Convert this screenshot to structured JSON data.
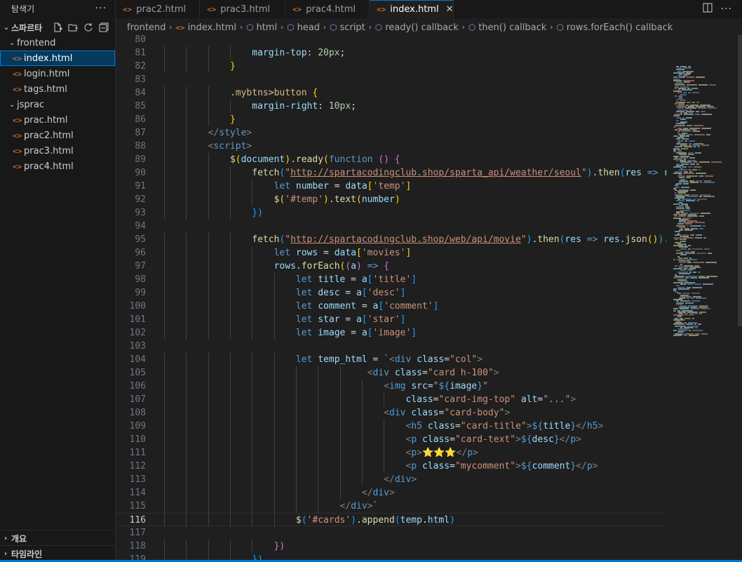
{
  "explorer": {
    "title": "탐색기",
    "more": "···",
    "workspace": "스파르타",
    "items": [
      {
        "label": "frontend",
        "kind": "folder",
        "indent": 1
      },
      {
        "label": "index.html",
        "kind": "file",
        "indent": 2,
        "active": true
      },
      {
        "label": "login.html",
        "kind": "file",
        "indent": 2
      },
      {
        "label": "tags.html",
        "kind": "file",
        "indent": 2
      },
      {
        "label": "jsprac",
        "kind": "folder",
        "indent": 1
      },
      {
        "label": "prac.html",
        "kind": "file",
        "indent": 2
      },
      {
        "label": "prac2.html",
        "kind": "file",
        "indent": 2
      },
      {
        "label": "prac3.html",
        "kind": "file",
        "indent": 2
      },
      {
        "label": "prac4.html",
        "kind": "file",
        "indent": 2
      }
    ],
    "outline_label": "개요",
    "timeline_label": "타임라인"
  },
  "tabs": [
    {
      "label": "prac2.html"
    },
    {
      "label": "prac3.html"
    },
    {
      "label": "prac4.html"
    },
    {
      "label": "index.html",
      "active": true
    }
  ],
  "breadcrumb": [
    "frontend",
    "index.html",
    "html",
    "head",
    "script",
    "ready() callback",
    "then() callback",
    "rows.forEach() callback"
  ],
  "editor": {
    "current_line": 116,
    "lines": [
      {
        "n": "80",
        "ind": 0,
        "html": ""
      },
      {
        "n": "81",
        "ind": 4,
        "html": "<span class='prop'>margin-top</span><span class='plain'>: </span><span class='num'>20px</span><span class='plain'>;</span>"
      },
      {
        "n": "82",
        "ind": 3,
        "html": "<span class='br1'>}</span>"
      },
      {
        "n": "83",
        "ind": 0,
        "html": ""
      },
      {
        "n": "84",
        "ind": 3,
        "html": "<span class='sel'>.mybtns</span><span class='plain'>&gt;</span><span class='sel'>button</span><span class='plain'> </span><span class='br1'>{</span>"
      },
      {
        "n": "85",
        "ind": 4,
        "html": "<span class='prop'>margin-right</span><span class='plain'>: </span><span class='num'>10px</span><span class='plain'>;</span>"
      },
      {
        "n": "86",
        "ind": 3,
        "html": "<span class='br1'>}</span>"
      },
      {
        "n": "87",
        "ind": 2,
        "html": "<span class='tag'>&lt;/</span><span class='tg'>style</span><span class='tag'>&gt;</span>"
      },
      {
        "n": "88",
        "ind": 2,
        "html": "<span class='tag'>&lt;</span><span class='tg'>script</span><span class='tag'>&gt;</span>"
      },
      {
        "n": "89",
        "ind": 3,
        "html": "<span class='fn'>$</span><span class='br1'>(</span><span class='var'>document</span><span class='br1'>)</span><span class='plain'>.</span><span class='fn'>ready</span><span class='br1'>(</span><span class='kw'>function</span><span class='plain'> </span><span class='br2'>()</span><span class='plain'> </span><span class='br2'>{</span>"
      },
      {
        "n": "90",
        "ind": 4,
        "html": "<span class='fn'>fetch</span><span class='br3'>(</span><span class='str'>\"</span><span class='url'>http://spartacodingclub.shop/sparta_api/weather/seoul</span><span class='str'>\"</span><span class='br3'>)</span><span class='plain'>.</span><span class='fn'>then</span><span class='br3'>(</span><span class='var'>res</span><span class='plain'> </span><span class='kw'>=&gt;</span><span class='plain'> </span><span class='var'>res</span><span class='plain'>.</span><span class='fn'>json</span><span class='br1'>()</span><span class='br3'>)</span>"
      },
      {
        "n": "91",
        "ind": 5,
        "html": "<span class='kw'>let</span><span class='plain'> </span><span class='var'>number</span><span class='plain'> = </span><span class='var'>data</span><span class='br1'>[</span><span class='str'>'temp'</span><span class='br1'>]</span>"
      },
      {
        "n": "92",
        "ind": 5,
        "html": "<span class='fn'>$</span><span class='br1'>(</span><span class='str'>'#temp'</span><span class='br1'>)</span><span class='plain'>.</span><span class='fn'>text</span><span class='br1'>(</span><span class='var'>number</span><span class='br1'>)</span>"
      },
      {
        "n": "93",
        "ind": 4,
        "html": "<span class='br3'>})</span>"
      },
      {
        "n": "94",
        "ind": 0,
        "html": ""
      },
      {
        "n": "95",
        "ind": 4,
        "html": "<span class='fn'>fetch</span><span class='br3'>(</span><span class='str'>\"</span><span class='url'>http://spartacodingclub.shop/web/api/movie</span><span class='str'>\"</span><span class='br3'>)</span><span class='plain'>.</span><span class='fn'>then</span><span class='br3'>(</span><span class='var'>res</span><span class='plain'> </span><span class='kw'>=&gt;</span><span class='plain'> </span><span class='var'>res</span><span class='plain'>.</span><span class='fn'>json</span><span class='br1'>()</span><span class='br3'>)</span><span class='plain'>.</span><span class='fn'>then</span><span class='br3'>((</span><span class='var'>data</span><span class='br3'>)</span>"
      },
      {
        "n": "96",
        "ind": 5,
        "html": "<span class='kw'>let</span><span class='plain'> </span><span class='var'>rows</span><span class='plain'> = </span><span class='var'>data</span><span class='br1'>[</span><span class='str'>'movies'</span><span class='br1'>]</span>"
      },
      {
        "n": "97",
        "ind": 5,
        "html": "<span class='var'>rows</span><span class='plain'>.</span><span class='fn'>forEach</span><span class='br1'>(</span><span class='br2'>(</span><span class='var'>a</span><span class='br2'>)</span><span class='plain'> </span><span class='kw'>=&gt;</span><span class='plain'> </span><span class='br2'>{</span>"
      },
      {
        "n": "98",
        "ind": 6,
        "html": "<span class='kw'>let</span><span class='plain'> </span><span class='var'>title</span><span class='plain'> = </span><span class='var'>a</span><span class='br3'>[</span><span class='str'>'title'</span><span class='br3'>]</span>"
      },
      {
        "n": "99",
        "ind": 6,
        "html": "<span class='kw'>let</span><span class='plain'> </span><span class='var'>desc</span><span class='plain'> = </span><span class='var'>a</span><span class='br3'>[</span><span class='str'>'desc'</span><span class='br3'>]</span>"
      },
      {
        "n": "100",
        "ind": 6,
        "html": "<span class='kw'>let</span><span class='plain'> </span><span class='var'>comment</span><span class='plain'> = </span><span class='var'>a</span><span class='br3'>[</span><span class='str'>'comment'</span><span class='br3'>]</span>"
      },
      {
        "n": "101",
        "ind": 6,
        "html": "<span class='kw'>let</span><span class='plain'> </span><span class='var'>star</span><span class='plain'> = </span><span class='var'>a</span><span class='br3'>[</span><span class='str'>'star'</span><span class='br3'>]</span>"
      },
      {
        "n": "102",
        "ind": 6,
        "html": "<span class='kw'>let</span><span class='plain'> </span><span class='var'>image</span><span class='plain'> = </span><span class='var'>a</span><span class='br3'>[</span><span class='str'>'image'</span><span class='br3'>]</span>"
      },
      {
        "n": "103",
        "ind": 0,
        "html": ""
      },
      {
        "n": "104",
        "ind": 6,
        "html": "<span class='kw'>let</span><span class='plain'> </span><span class='var'>temp_html</span><span class='plain'> = </span><span class='str'>`</span><span class='tag'>&lt;</span><span class='tg'>div</span><span class='plain'> </span><span class='var'>class</span><span class='plain'>=</span><span class='str'>\"col\"</span><span class='tag'>&gt;</span>"
      },
      {
        "n": "105",
        "ind": 6,
        "pad": 13,
        "html": "<span class='tag'>&lt;</span><span class='tg'>div</span><span class='plain'> </span><span class='var'>class</span><span class='plain'>=</span><span class='str'>\"card h-100\"</span><span class='tag'>&gt;</span>"
      },
      {
        "n": "106",
        "ind": 6,
        "pad": 16,
        "html": "<span class='tag'>&lt;</span><span class='tg'>img</span><span class='plain'> </span><span class='var'>src</span><span class='plain'>=</span><span class='str'>\"</span><span class='kw'>${</span><span class='var'>image</span><span class='kw'>}</span><span class='str'>\"</span>"
      },
      {
        "n": "107",
        "ind": 6,
        "pad": 20,
        "html": "<span class='var'>class</span><span class='plain'>=</span><span class='str'>\"card-img-top\"</span><span class='plain'> </span><span class='var'>alt</span><span class='plain'>=</span><span class='str'>\"...\"</span><span class='tag'>&gt;</span>"
      },
      {
        "n": "108",
        "ind": 6,
        "pad": 16,
        "html": "<span class='tag'>&lt;</span><span class='tg'>div</span><span class='plain'> </span><span class='var'>class</span><span class='plain'>=</span><span class='str'>\"card-body\"</span><span class='tag'>&gt;</span>"
      },
      {
        "n": "109",
        "ind": 6,
        "pad": 20,
        "html": "<span class='tag'>&lt;</span><span class='tg'>h5</span><span class='plain'> </span><span class='var'>class</span><span class='plain'>=</span><span class='str'>\"card-title\"</span><span class='tag'>&gt;</span><span class='kw'>${</span><span class='var'>title</span><span class='kw'>}</span><span class='tag'>&lt;/</span><span class='tg'>h5</span><span class='tag'>&gt;</span>"
      },
      {
        "n": "110",
        "ind": 6,
        "pad": 20,
        "html": "<span class='tag'>&lt;</span><span class='tg'>p</span><span class='plain'> </span><span class='var'>class</span><span class='plain'>=</span><span class='str'>\"card-text\"</span><span class='tag'>&gt;</span><span class='kw'>${</span><span class='var'>desc</span><span class='kw'>}</span><span class='tag'>&lt;/</span><span class='tg'>p</span><span class='tag'>&gt;</span>"
      },
      {
        "n": "111",
        "ind": 6,
        "pad": 20,
        "html": "<span class='tag'>&lt;</span><span class='tg'>p</span><span class='tag'>&gt;</span><span class='br1'>⭐⭐⭐</span><span class='tag'>&lt;/</span><span class='tg'>p</span><span class='tag'>&gt;</span>"
      },
      {
        "n": "112",
        "ind": 6,
        "pad": 20,
        "html": "<span class='tag'>&lt;</span><span class='tg'>p</span><span class='plain'> </span><span class='var'>class</span><span class='plain'>=</span><span class='str'>\"mycomment\"</span><span class='tag'>&gt;</span><span class='kw'>${</span><span class='var'>comment</span><span class='kw'>}</span><span class='tag'>&lt;/</span><span class='tg'>p</span><span class='tag'>&gt;</span>"
      },
      {
        "n": "113",
        "ind": 6,
        "pad": 16,
        "html": "<span class='tag'>&lt;/</span><span class='tg'>div</span><span class='tag'>&gt;</span>"
      },
      {
        "n": "114",
        "ind": 6,
        "pad": 12,
        "html": "<span class='tag'>&lt;/</span><span class='tg'>div</span><span class='tag'>&gt;</span>"
      },
      {
        "n": "115",
        "ind": 6,
        "pad": 8,
        "html": "<span class='tag'>&lt;/</span><span class='tg'>div</span><span class='tag'>&gt;</span><span class='str'>`</span>"
      },
      {
        "n": "116",
        "ind": 6,
        "html": "<span class='fn'>$</span><span class='br3'>(</span><span class='str'>'#cards'</span><span class='br3'>)</span><span class='plain'>.</span><span class='fn'>append</span><span class='br3'>(</span><span class='var'>temp</span><span class='plain'>.</span><span class='var'>html</span><span class='br3'>)</span>"
      },
      {
        "n": "117",
        "ind": 0,
        "html": ""
      },
      {
        "n": "118",
        "ind": 5,
        "html": "<span class='br2'>})</span>"
      },
      {
        "n": "119",
        "ind": 4,
        "html": "<span class='br3'>})</span>"
      }
    ]
  },
  "colors": {
    "accent": "#0078d4",
    "file_icon": "#e37933",
    "symbol_icon": "#b180d7"
  }
}
